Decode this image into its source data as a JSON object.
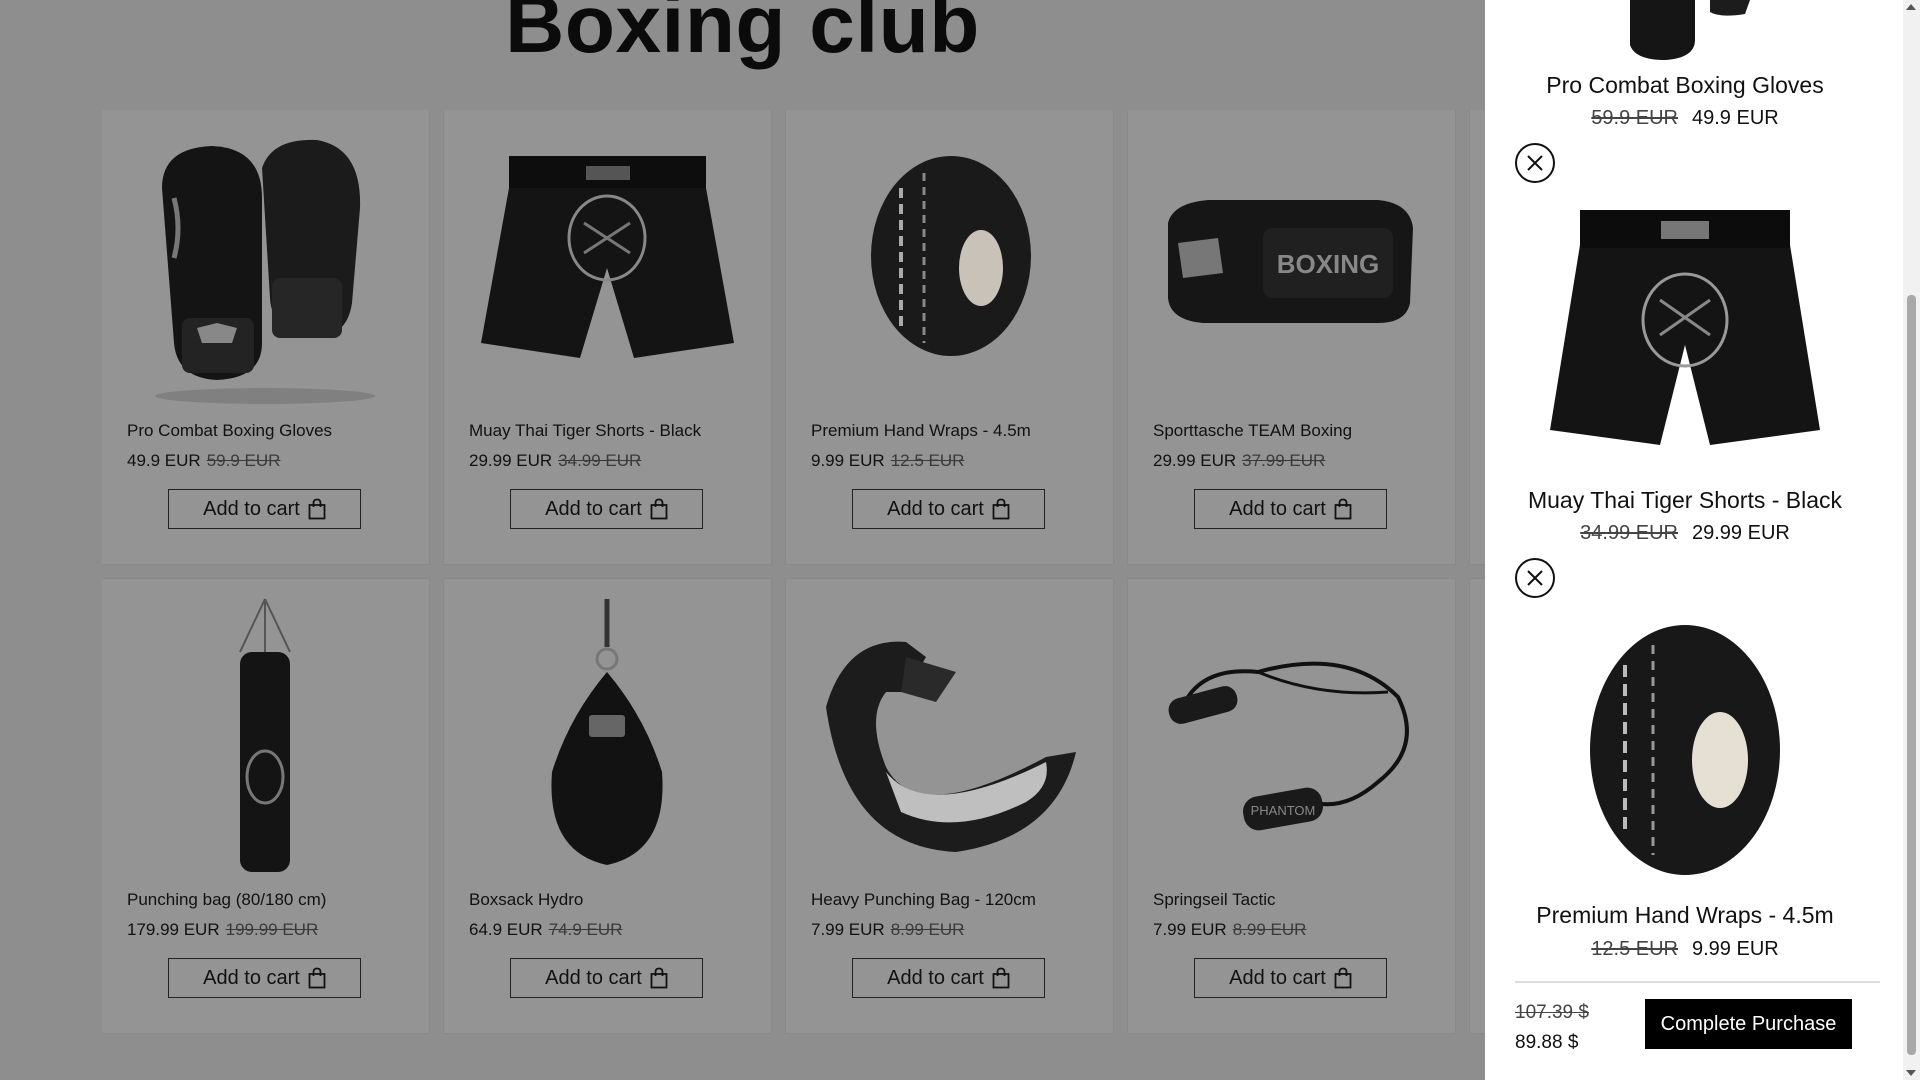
{
  "page": {
    "title": "Boxing club"
  },
  "add_to_cart_label": "Add to cart",
  "products": [
    {
      "name": "Pro Combat Boxing Gloves",
      "price": "49.9 EUR",
      "old_price": "59.9 EUR",
      "icon": "boxing-gloves"
    },
    {
      "name": "Muay Thai Tiger Shorts - Black",
      "price": "29.99 EUR",
      "old_price": "34.99 EUR",
      "icon": "shorts"
    },
    {
      "name": "Premium Hand Wraps - 4.5m",
      "price": "9.99 EUR",
      "old_price": "12.5 EUR",
      "icon": "tape-roll"
    },
    {
      "name": "Sporttasche TEAM Boxing",
      "price": "29.99 EUR",
      "old_price": "37.99 EUR",
      "icon": "sports-bag"
    },
    {
      "name": "Punching bag (80/180 cm)",
      "price": "179.99 EUR",
      "old_price": "199.99 EUR",
      "icon": "punching-bag"
    },
    {
      "name": "Boxsack Hydro",
      "price": "64.9 EUR",
      "old_price": "74.9 EUR",
      "icon": "hydro-bag"
    },
    {
      "name": "Heavy Punching Bag - 120cm",
      "price": "7.99 EUR",
      "old_price": "8.99 EUR",
      "icon": "mouthguard"
    },
    {
      "name": "Springseil Tactic",
      "price": "7.99 EUR",
      "old_price": "8.99 EUR",
      "icon": "jump-rope"
    }
  ],
  "cart": {
    "items": [
      {
        "name": "Pro Combat Boxing Gloves",
        "old_price": "59.9 EUR",
        "price": "49.9 EUR"
      },
      {
        "name": "Muay Thai Tiger Shorts - Black",
        "old_price": "34.99 EUR",
        "price": "29.99 EUR"
      },
      {
        "name": "Premium Hand Wraps - 4.5m",
        "old_price": "12.5 EUR",
        "price": "9.99 EUR"
      }
    ],
    "total_old": "107.39 $",
    "total": "89.88 $",
    "purchase_label": "Complete Purchase"
  }
}
